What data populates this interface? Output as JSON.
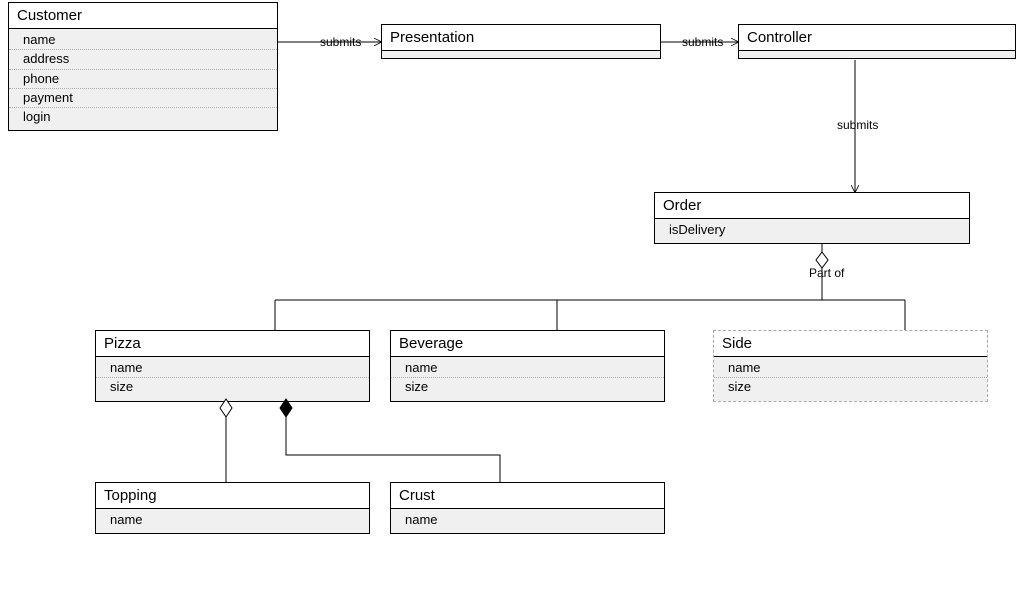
{
  "classes": {
    "customer": {
      "title": "Customer",
      "attrs": [
        "name",
        "address",
        "phone",
        "payment",
        "login"
      ]
    },
    "presentation": {
      "title": "Presentation",
      "attrs": []
    },
    "controller": {
      "title": "Controller",
      "attrs": []
    },
    "order": {
      "title": "Order",
      "attrs": [
        "isDelivery"
      ]
    },
    "pizza": {
      "title": "Pizza",
      "attrs": [
        "name",
        "size"
      ]
    },
    "beverage": {
      "title": "Beverage",
      "attrs": [
        "name",
        "size"
      ]
    },
    "side": {
      "title": "Side",
      "attrs": [
        "name",
        "size"
      ]
    },
    "topping": {
      "title": "Topping",
      "attrs": [
        "name"
      ]
    },
    "crust": {
      "title": "Crust",
      "attrs": [
        "name"
      ]
    }
  },
  "edges": {
    "e1": {
      "label": "submits"
    },
    "e2": {
      "label": "submits"
    },
    "e3": {
      "label": "submits"
    },
    "e4": {
      "label": "Part of"
    }
  }
}
